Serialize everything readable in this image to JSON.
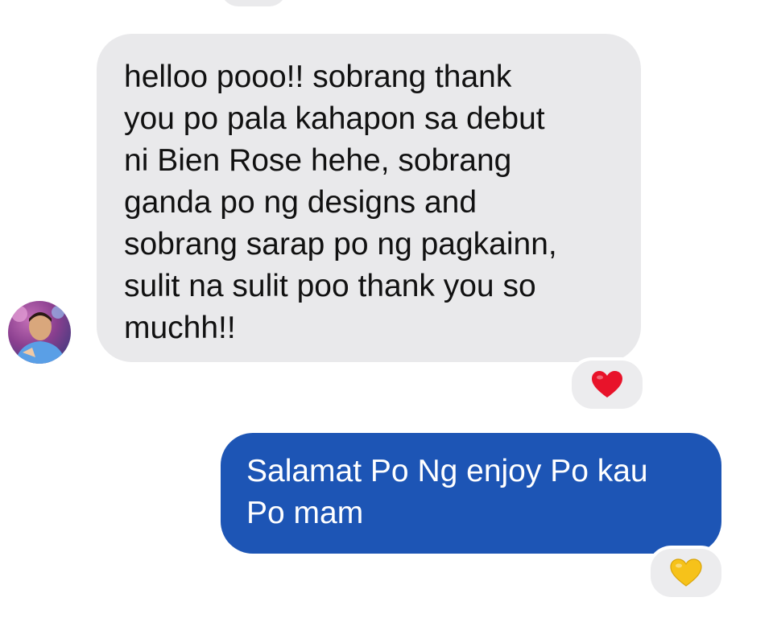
{
  "conversation": {
    "received_message": {
      "text": "helloo pooo!! sobrang thank\nyou po pala kahapon sa debut\nni Bien Rose hehe, sobrang\nganda po ng designs and\nsobrang sarap po ng pagkainn,\nsulit na sulit poo thank you so\nmuchh!!",
      "reaction": "red-heart-icon",
      "reaction_color": "#e8132a"
    },
    "sent_message": {
      "text": "Salamat Po Ng enjoy Po kau\nPo mam",
      "reaction": "yellow-heart-icon",
      "reaction_color": "#f6c21a"
    }
  },
  "colors": {
    "received_bubble": "#e9e9eb",
    "sent_bubble": "#1d55b5",
    "background": "#ffffff"
  }
}
